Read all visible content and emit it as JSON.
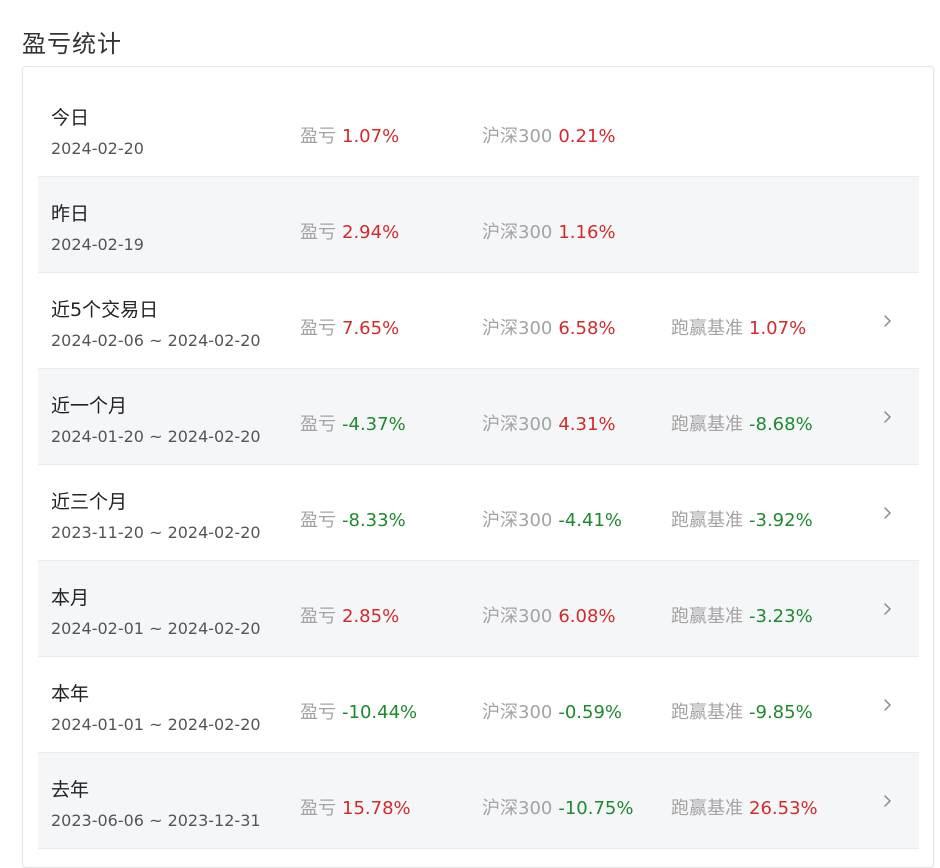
{
  "title": "盈亏统计",
  "labels": {
    "pnl": "盈亏",
    "index": "沪深300",
    "excess": "跑赢基准"
  },
  "colors": {
    "up": "#d42a2a",
    "down": "#1e8a2e"
  },
  "rows": [
    {
      "period": "今日",
      "date": "2024-02-20",
      "pnl": "1.07%",
      "pnl_dir": "up",
      "index": "0.21%",
      "index_dir": "up",
      "excess": null,
      "excess_dir": null
    },
    {
      "period": "昨日",
      "date": "2024-02-19",
      "pnl": "2.94%",
      "pnl_dir": "up",
      "index": "1.16%",
      "index_dir": "up",
      "excess": null,
      "excess_dir": null
    },
    {
      "period": "近5个交易日",
      "date": "2024-02-06 ~ 2024-02-20",
      "pnl": "7.65%",
      "pnl_dir": "up",
      "index": "6.58%",
      "index_dir": "up",
      "excess": "1.07%",
      "excess_dir": "up"
    },
    {
      "period": "近一个月",
      "date": "2024-01-20 ~ 2024-02-20",
      "pnl": "-4.37%",
      "pnl_dir": "down",
      "index": "4.31%",
      "index_dir": "up",
      "excess": "-8.68%",
      "excess_dir": "down"
    },
    {
      "period": "近三个月",
      "date": "2023-11-20 ~ 2024-02-20",
      "pnl": "-8.33%",
      "pnl_dir": "down",
      "index": "-4.41%",
      "index_dir": "down",
      "excess": "-3.92%",
      "excess_dir": "down"
    },
    {
      "period": "本月",
      "date": "2024-02-01 ~ 2024-02-20",
      "pnl": "2.85%",
      "pnl_dir": "up",
      "index": "6.08%",
      "index_dir": "up",
      "excess": "-3.23%",
      "excess_dir": "down"
    },
    {
      "period": "本年",
      "date": "2024-01-01 ~ 2024-02-20",
      "pnl": "-10.44%",
      "pnl_dir": "down",
      "index": "-0.59%",
      "index_dir": "down",
      "excess": "-9.85%",
      "excess_dir": "down"
    },
    {
      "period": "去年",
      "date": "2023-06-06 ~ 2023-12-31",
      "pnl": "15.78%",
      "pnl_dir": "up",
      "index": "-10.75%",
      "index_dir": "down",
      "excess": "26.53%",
      "excess_dir": "up"
    }
  ]
}
